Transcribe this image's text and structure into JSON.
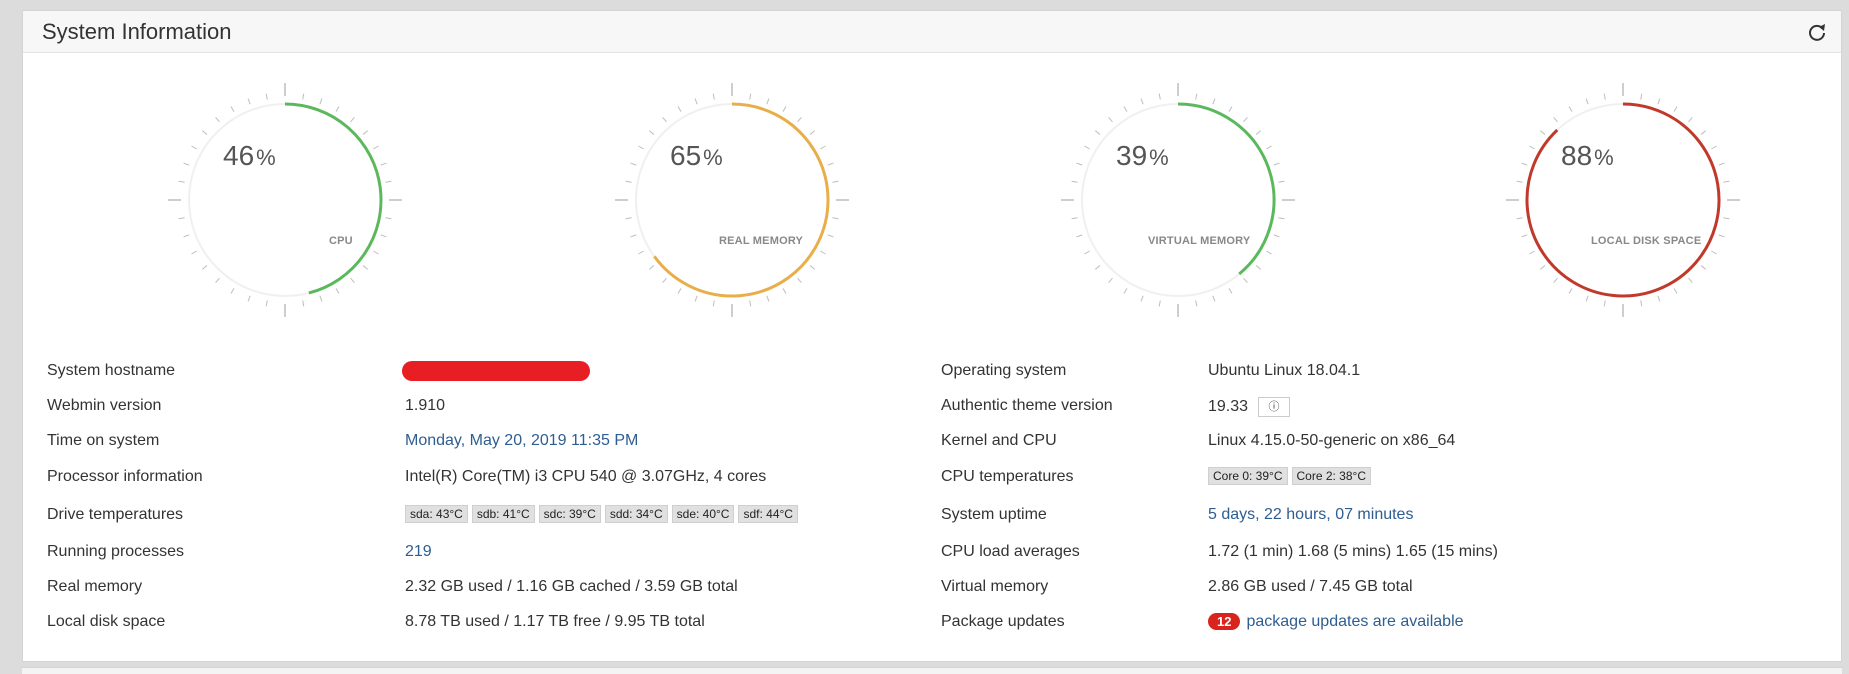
{
  "panel": {
    "title": "System Information"
  },
  "gauges": [
    {
      "id": "cpu",
      "value": "46",
      "pct": "%",
      "label": "CPU",
      "percent": 46,
      "color": "#5cb85c"
    },
    {
      "id": "real-memory",
      "value": "65",
      "pct": "%",
      "label": "REAL MEMORY",
      "percent": 65,
      "color": "#e8ae4a"
    },
    {
      "id": "virtual-memory",
      "value": "39",
      "pct": "%",
      "label": "VIRTUAL MEMORY",
      "percent": 39,
      "color": "#5cb85c"
    },
    {
      "id": "local-disk",
      "value": "88",
      "pct": "%",
      "label": "LOCAL DISK SPACE",
      "percent": 88,
      "color": "#c0392b"
    }
  ],
  "left": {
    "hostname_label": "System hostname",
    "webmin_label": "Webmin version",
    "webmin_value": "1.910",
    "time_label": "Time on system",
    "time_value": "Monday, May 20, 2019 11:35 PM",
    "proc_label": "Processor information",
    "proc_value": "Intel(R) Core(TM) i3 CPU 540 @ 3.07GHz, 4 cores",
    "drive_label": "Drive temperatures",
    "drive_tags": [
      "sda: 43°C",
      "sdb: 41°C",
      "sdc: 39°C",
      "sdd: 34°C",
      "sde: 40°C",
      "sdf: 44°C"
    ],
    "running_label": "Running processes",
    "running_value": "219",
    "realmem_label": "Real memory",
    "realmem_value": "2.32 GB used / 1.16 GB cached / 3.59 GB total",
    "disk_label": "Local disk space",
    "disk_value": "8.78 TB used / 1.17 TB free / 9.95 TB total"
  },
  "right": {
    "os_label": "Operating system",
    "os_value": "Ubuntu Linux 18.04.1",
    "theme_label": "Authentic theme version",
    "theme_value": "19.33",
    "kernel_label": "Kernel and CPU",
    "kernel_value": "Linux 4.15.0-50-generic on x86_64",
    "cputemp_label": "CPU temperatures",
    "cputemp_tags": [
      "Core 0: 39°C",
      "Core 2: 38°C"
    ],
    "uptime_label": "System uptime",
    "uptime_value": "5 days, 22 hours, 07 minutes",
    "load_label": "CPU load averages",
    "load_value": "1.72 (1 min) 1.68 (5 mins) 1.65 (15 mins)",
    "vmem_label": "Virtual memory",
    "vmem_value": "2.86 GB used / 7.45 GB total",
    "pkg_label": "Package updates",
    "pkg_count": "12",
    "pkg_value": "package updates are available"
  },
  "colors": {
    "link": "#2e5d91",
    "badge": "#d9231d"
  }
}
